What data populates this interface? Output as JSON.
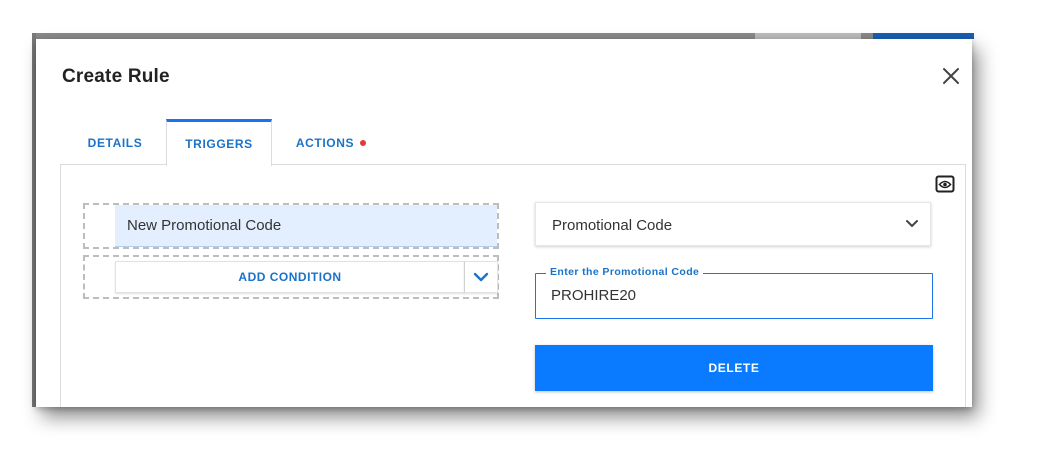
{
  "dialog": {
    "title": "Create Rule"
  },
  "tabs": [
    {
      "label": "DETAILS",
      "active": false
    },
    {
      "label": "TRIGGERS",
      "active": true
    },
    {
      "label": "ACTIONS",
      "active": false,
      "has_alert_dot": true
    }
  ],
  "trigger": {
    "name": "New Promotional Code",
    "add_condition_label": "ADD CONDITION"
  },
  "trigger_type": {
    "selected": "Promotional Code"
  },
  "promo_field": {
    "label": "Enter the Promotional Code",
    "value": "PROHIRE20"
  },
  "delete_label": "DELETE",
  "icons": {
    "close": "close-icon",
    "preview": "eye-icon",
    "dropdown": "chevron-down-icon"
  },
  "colors": {
    "accent": "#1a73e8",
    "button": "#0a7bff",
    "alert_dot": "#e53935",
    "selected_row": "#e3efff"
  }
}
